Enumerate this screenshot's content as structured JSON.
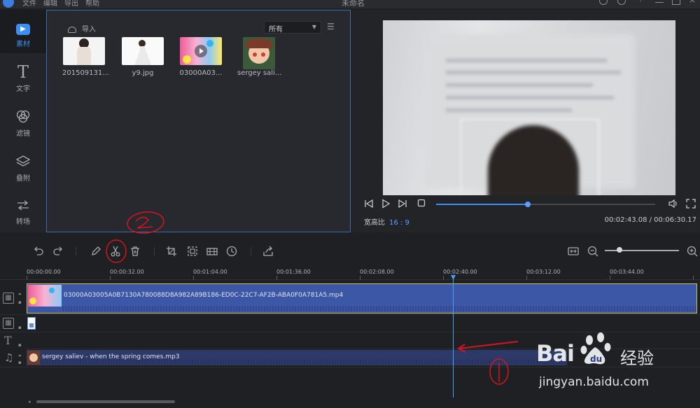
{
  "titlebar": {
    "menus": [
      "文件",
      "编辑",
      "导出",
      "帮助"
    ],
    "document_title": "未命名"
  },
  "sidebar": {
    "items": [
      {
        "label": "素材",
        "icon": "media-icon",
        "active": true
      },
      {
        "label": "文字",
        "icon": "text-icon",
        "active": false
      },
      {
        "label": "滤镜",
        "icon": "filter-icon",
        "active": false
      },
      {
        "label": "叠附",
        "icon": "overlay-icon",
        "active": false
      },
      {
        "label": "转场",
        "icon": "transition-icon",
        "active": false
      }
    ]
  },
  "media": {
    "import_label": "导入",
    "filter_value": "所有",
    "items": [
      {
        "name": "201509131..."
      },
      {
        "name": "y9.jpg"
      },
      {
        "name": "03000A03..."
      },
      {
        "name": "sergey sali..."
      }
    ]
  },
  "preview": {
    "progress": 0.42,
    "aspect_label": "宽高比",
    "aspect_value": "16 : 9",
    "timecode": "00:02:43.08 / 00:06:30.17"
  },
  "timeline": {
    "ruler_labels": [
      "00:00:00.00",
      "00:00:32.00",
      "00:01:04.00",
      "00:01:36.00",
      "00:02:08.00",
      "00:02:40.00",
      "00:03:12.00",
      "00:03:44.00"
    ],
    "video_clip_name": "03000A03005A0B7130A780088D8A982A89B186-ED0C-22C7-AF2B-ABA0F0A781A5.mp4",
    "audio_clip_name": "sergey saliev - when the spring comes.mp3",
    "zoom_level": 0.2
  },
  "watermark": {
    "brand": "Bai",
    "brand_cn": "经验",
    "url": "jingyan.baidu.com"
  },
  "colors": {
    "accent": "#3d8ef2",
    "annotation": "#d4141e",
    "video_clip": "#3c57a5"
  }
}
